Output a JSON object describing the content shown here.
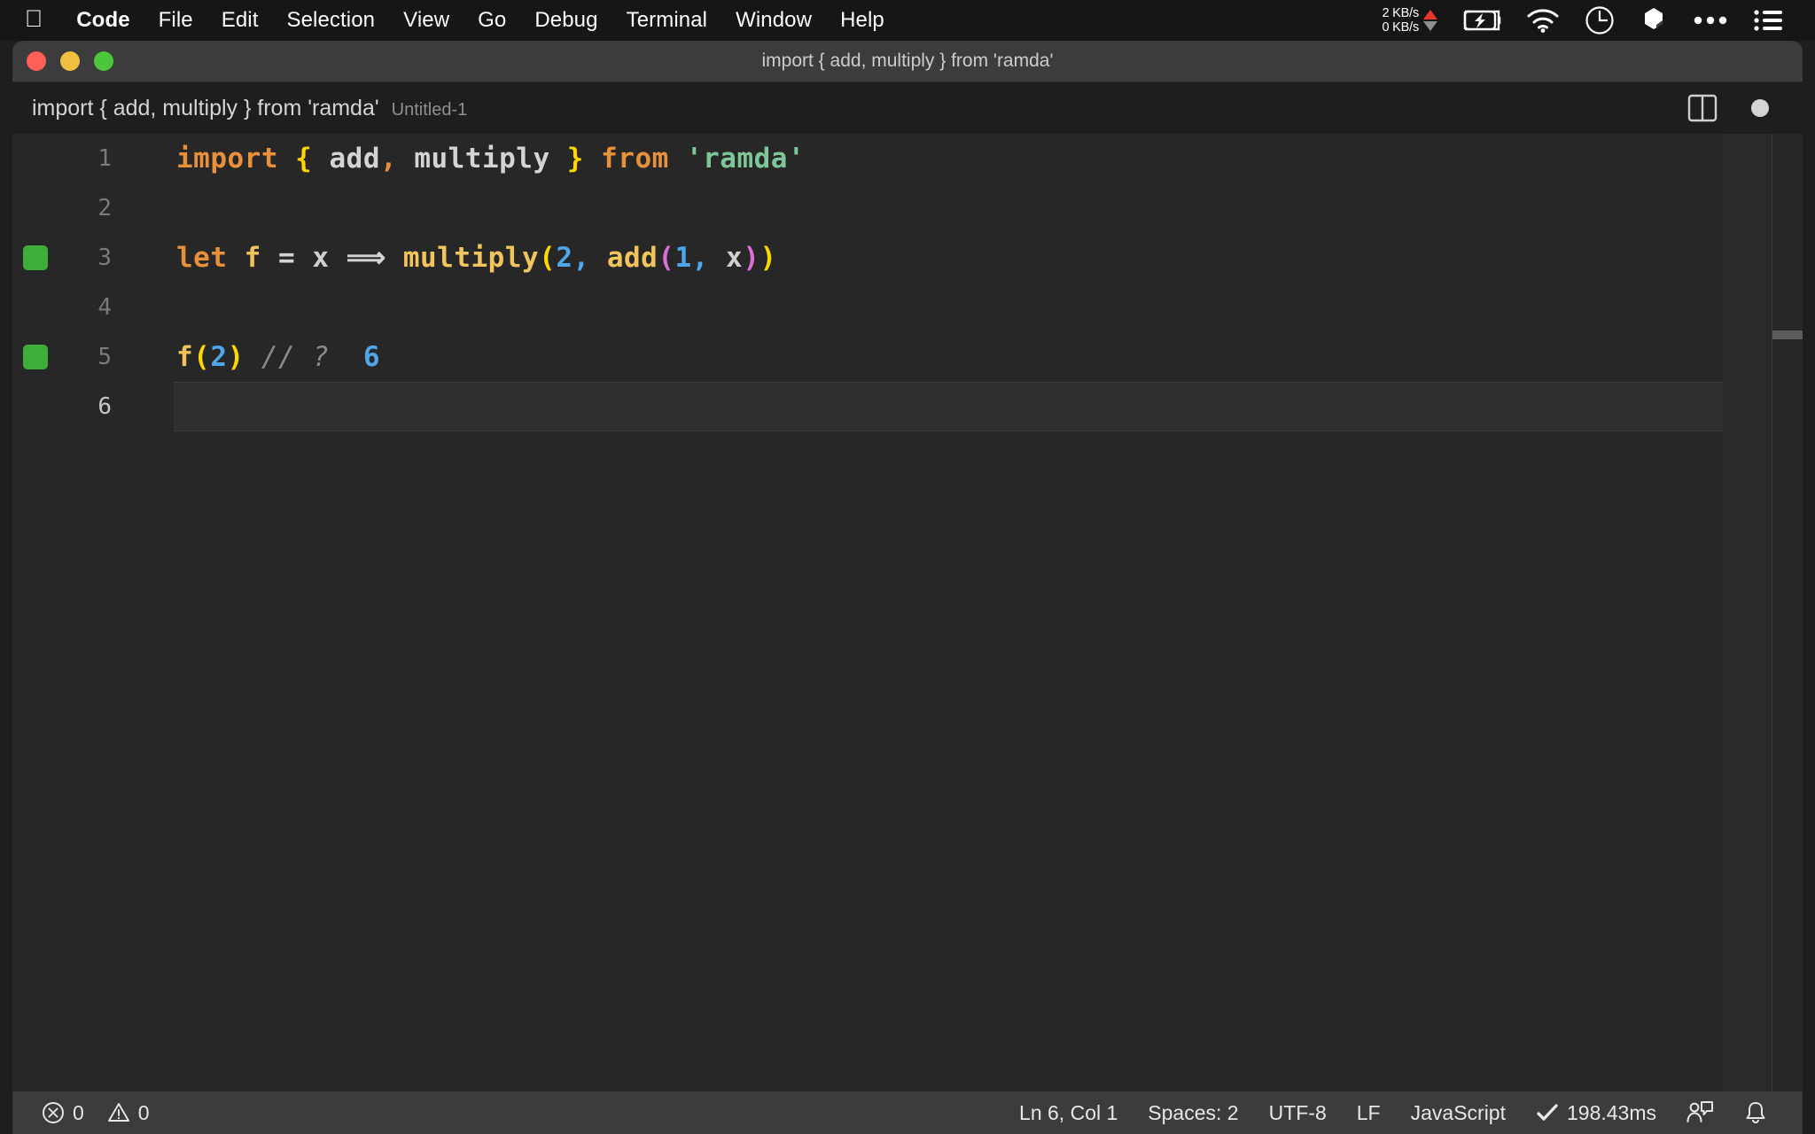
{
  "menubar": {
    "apple_icon": "apple-logo-icon",
    "items": [
      {
        "label": "Code",
        "bold": true
      },
      {
        "label": "File",
        "bold": false
      },
      {
        "label": "Edit",
        "bold": false
      },
      {
        "label": "Selection",
        "bold": false
      },
      {
        "label": "View",
        "bold": false
      },
      {
        "label": "Go",
        "bold": false
      },
      {
        "label": "Debug",
        "bold": false
      },
      {
        "label": "Terminal",
        "bold": false
      },
      {
        "label": "Window",
        "bold": false
      },
      {
        "label": "Help",
        "bold": false
      }
    ],
    "status_items": {
      "network_up": "2 KB/s",
      "network_down": "0 KB/s",
      "up_arrow_color": "#e8372a",
      "down_arrow_color": "#8e8e90",
      "battery_icon": "battery-charging-icon",
      "wifi_icon": "wifi-icon",
      "clock_icon": "clock-icon",
      "dropbox_icon": "dropbox-icon",
      "more_icon": "ellipsis-icon",
      "control_center_icon": "list-menu-icon"
    }
  },
  "window": {
    "title": "import { add, multiply } from 'ramda'",
    "traffic_lights": [
      "close-button",
      "minimize-button",
      "maximize-button"
    ],
    "colors": {
      "close": "#ff5f57",
      "minimize": "#f0bf3f",
      "maximize": "#4cc73c",
      "titlebar_bg": "#3c3c3c",
      "editor_bg": "#272727",
      "statusbar_bg": "#3c3c3c",
      "live_marker": "#3dae3a"
    }
  },
  "breadcrumb": {
    "path_label": "import { add, multiply } from 'ramda'",
    "file_label": "Untitled-1"
  },
  "editor_actions": {
    "split_editor_icon": "split-editor-icon",
    "dirty_indicator": "unsaved-dot-icon"
  },
  "editor": {
    "lines": [
      {
        "number": "1",
        "active": false,
        "live_marker": false,
        "tokens": [
          {
            "text": "import",
            "cls": "t-kw"
          },
          {
            "text": " ",
            "cls": "t-plain"
          },
          {
            "text": "{",
            "cls": "t-brc-y"
          },
          {
            "text": " add",
            "cls": "t-plain"
          },
          {
            "text": ",",
            "cls": "t-kw"
          },
          {
            "text": " multiply ",
            "cls": "t-plain"
          },
          {
            "text": "}",
            "cls": "t-brc-y"
          },
          {
            "text": " ",
            "cls": "t-plain"
          },
          {
            "text": "from",
            "cls": "t-kw"
          },
          {
            "text": " ",
            "cls": "t-plain"
          },
          {
            "text": "'ramda'",
            "cls": "t-str"
          }
        ]
      },
      {
        "number": "2",
        "active": false,
        "live_marker": false,
        "tokens": []
      },
      {
        "number": "3",
        "active": false,
        "live_marker": true,
        "tokens": [
          {
            "text": "let",
            "cls": "t-kw"
          },
          {
            "text": " ",
            "cls": "t-plain"
          },
          {
            "text": "f",
            "cls": "t-fn"
          },
          {
            "text": " ",
            "cls": "t-plain"
          },
          {
            "text": "=",
            "cls": "t-op"
          },
          {
            "text": " ",
            "cls": "t-plain"
          },
          {
            "text": "x",
            "cls": "t-var"
          },
          {
            "text": " ",
            "cls": "t-plain"
          },
          {
            "text": "⟹",
            "cls": "t-op"
          },
          {
            "text": " ",
            "cls": "t-plain"
          },
          {
            "text": "multiply",
            "cls": "t-fn"
          },
          {
            "text": "(",
            "cls": "t-brc-y"
          },
          {
            "text": "2",
            "cls": "t-num"
          },
          {
            "text": ",",
            "cls": "t-num"
          },
          {
            "text": " ",
            "cls": "t-plain"
          },
          {
            "text": "add",
            "cls": "t-fn"
          },
          {
            "text": "(",
            "cls": "t-brc-m"
          },
          {
            "text": "1",
            "cls": "t-num"
          },
          {
            "text": ",",
            "cls": "t-num"
          },
          {
            "text": " ",
            "cls": "t-plain"
          },
          {
            "text": "x",
            "cls": "t-var"
          },
          {
            "text": ")",
            "cls": "t-brc-m"
          },
          {
            "text": ")",
            "cls": "t-brc-y"
          }
        ]
      },
      {
        "number": "4",
        "active": false,
        "live_marker": false,
        "tokens": []
      },
      {
        "number": "5",
        "active": false,
        "live_marker": true,
        "tokens": [
          {
            "text": "f",
            "cls": "t-fn"
          },
          {
            "text": "(",
            "cls": "t-brc-y"
          },
          {
            "text": "2",
            "cls": "t-num"
          },
          {
            "text": ")",
            "cls": "t-brc-y"
          },
          {
            "text": " ",
            "cls": "t-plain"
          },
          {
            "text": "// ?",
            "cls": "t-cmt"
          },
          {
            "text": "  ",
            "cls": "t-plain"
          },
          {
            "text": "6",
            "cls": "t-res"
          }
        ]
      },
      {
        "number": "6",
        "active": true,
        "live_marker": false,
        "tokens": []
      }
    ]
  },
  "statusbar": {
    "errors_icon": "error-circle-icon",
    "errors_count": "0",
    "warnings_icon": "warning-triangle-icon",
    "warnings_count": "0",
    "cursor_position": "Ln 6, Col 1",
    "indentation": "Spaces: 2",
    "encoding": "UTF-8",
    "line_endings": "LF",
    "language_mode": "JavaScript",
    "run_check_icon": "check-icon",
    "run_time": "198.43ms",
    "feedback_icon": "feedback-person-icon",
    "notifications_icon": "bell-icon"
  }
}
